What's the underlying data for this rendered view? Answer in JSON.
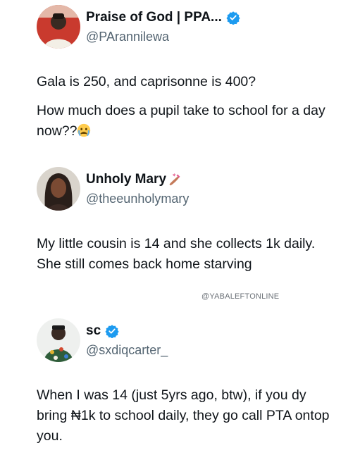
{
  "posts": [
    {
      "display_name": "Praise of God | PPA...",
      "handle": "@PArannilewa",
      "verified": true,
      "avatar_icon": "avatar-man-red-background",
      "text_paragraphs": [
        "Gala is 250, and caprisonne is 400?",
        "How much does a pupil take to school for a day now??"
      ],
      "trailing_emoji": "crying-face-emoji"
    },
    {
      "display_name": "Unholy Mary",
      "handle": "@theeunholymary",
      "verified": false,
      "avatar_icon": "avatar-woman",
      "name_emoji": "nail-polish-emoji",
      "text_paragraphs": [
        "My little cousin is 14 and she collects 1k daily. She still comes back home starving"
      ]
    },
    {
      "display_name": "sc",
      "handle": "@sxdiqcarter_",
      "verified": true,
      "avatar_icon": "avatar-man-patterned-shirt",
      "text_paragraphs": [
        "When I was 14 (just 5yrs ago, btw), if you dy bring ₦1k to school daily, they go call PTA ontop you."
      ]
    }
  ],
  "watermark": "@YABALEFTONLINE",
  "colors": {
    "verified_blue": "#1d9bf0",
    "handle_gray": "#536471",
    "text": "#0f1419"
  }
}
